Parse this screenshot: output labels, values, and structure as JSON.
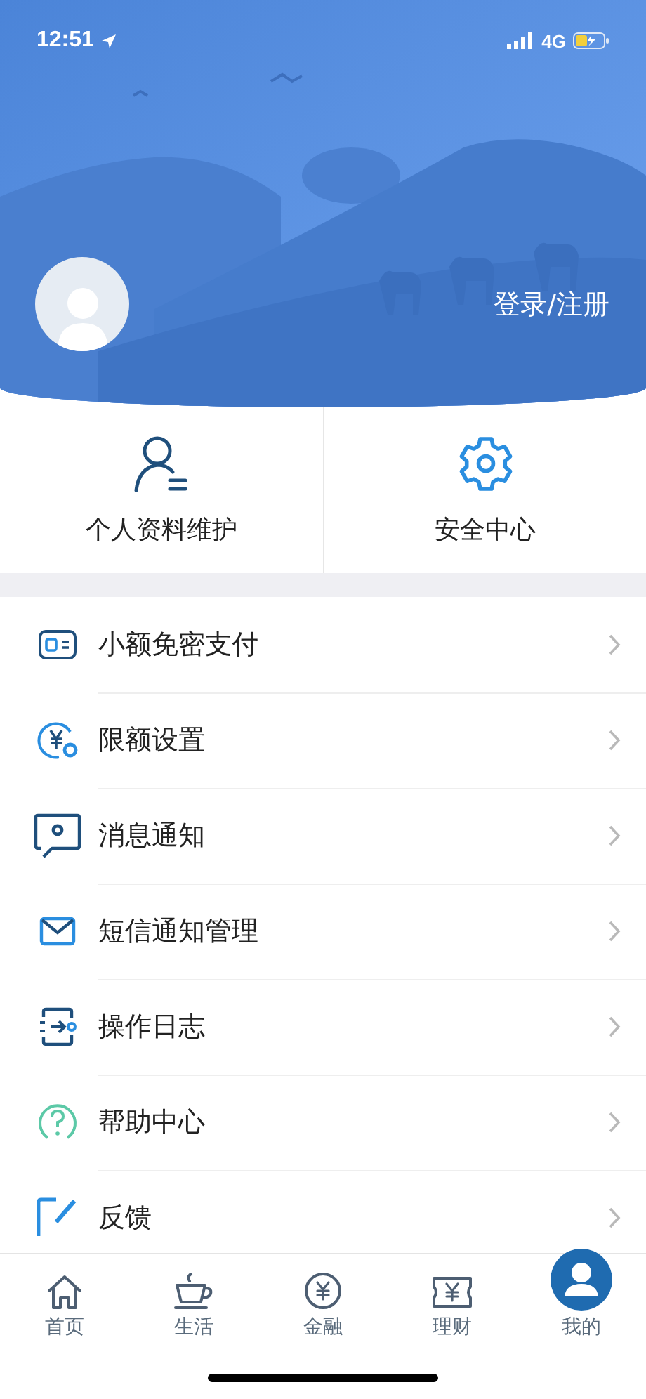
{
  "status_bar": {
    "time": "12:51",
    "network": "4G"
  },
  "profile": {
    "login_link": "登录/注册"
  },
  "quick_links": [
    {
      "label": "个人资料维护",
      "kind": "profile"
    },
    {
      "label": "安全中心",
      "kind": "security"
    }
  ],
  "menu": [
    {
      "label": "小额免密支付",
      "kind": "card"
    },
    {
      "label": "限额设置",
      "kind": "limit"
    },
    {
      "label": "消息通知",
      "kind": "message"
    },
    {
      "label": "短信通知管理",
      "kind": "mail"
    },
    {
      "label": "操作日志",
      "kind": "log"
    },
    {
      "label": "帮助中心",
      "kind": "help"
    },
    {
      "label": "反馈",
      "kind": "feedback"
    }
  ],
  "tab_bar": [
    {
      "label": "首页",
      "kind": "home",
      "selected": false
    },
    {
      "label": "生活",
      "kind": "life",
      "selected": false
    },
    {
      "label": "金融",
      "kind": "finance",
      "selected": false
    },
    {
      "label": "理财",
      "kind": "wealth",
      "selected": false
    },
    {
      "label": "我的",
      "kind": "me",
      "selected": true
    }
  ]
}
